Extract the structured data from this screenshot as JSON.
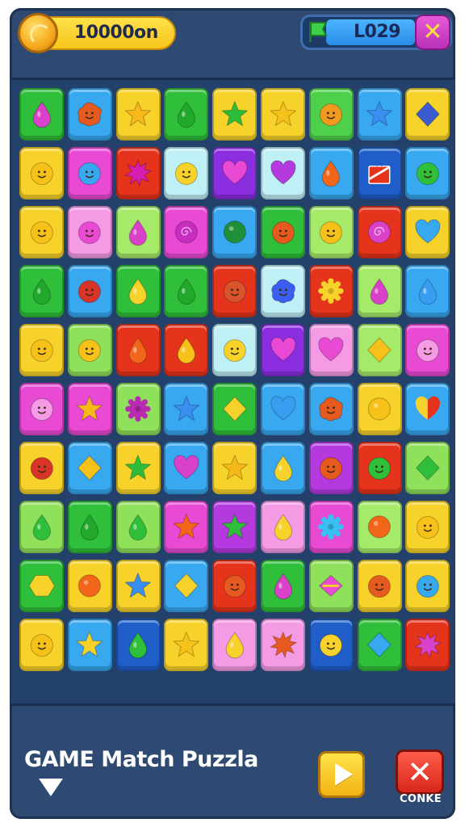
{
  "header": {
    "coins": "10000on",
    "level": "L029",
    "close_symbol": "✕",
    "coin_icon": "gold-coin-icon",
    "level_icon": "green-flag-icon"
  },
  "board": {
    "rows": 10,
    "cols": 9,
    "tiles": [
      [
        [
          "#2fbf3a",
          "drop",
          "#d942c8"
        ],
        [
          "#38a8f0",
          "blob",
          "#e55a1f"
        ],
        [
          "#f6d22a",
          "star",
          "#f6b81a"
        ],
        [
          "#2fbf3a",
          "drop",
          "#22a82a"
        ],
        [
          "#f6d22a",
          "star",
          "#2ebd3a"
        ],
        [
          "#f6d22a",
          "star",
          "#f6c21a"
        ],
        [
          "#4fd04a",
          "face",
          "#f19a20"
        ],
        [
          "#38a8f0",
          "star",
          "#3a8ef0"
        ],
        [
          "#f6d22a",
          "diamond",
          "#3b5bd0"
        ]
      ],
      [
        [
          "#f6d22a",
          "face",
          "#f6c21a"
        ],
        [
          "#e84ad4",
          "face",
          "#38a8f0"
        ],
        [
          "#e6341c",
          "splat",
          "#d61eb0"
        ],
        [
          "#bff0f5",
          "face",
          "#f6d22a"
        ],
        [
          "#8a2ee0",
          "heart",
          "#e84ad4"
        ],
        [
          "#bff0f5",
          "heart",
          "#b43ae0"
        ],
        [
          "#38a8f0",
          "drop",
          "#f2661a"
        ],
        [
          "#1f5ec8",
          "gift",
          "#e6341c"
        ],
        [
          "#38a8f0",
          "face",
          "#2fbf3a"
        ]
      ],
      [
        [
          "#f6d22a",
          "face",
          "#f6c21a"
        ],
        [
          "#f59be6",
          "face",
          "#e84ad4"
        ],
        [
          "#a6ea6a",
          "drop",
          "#d942c8"
        ],
        [
          "#e84ad4",
          "swirl",
          "#c72ec0"
        ],
        [
          "#38a8f0",
          "circle",
          "#1f8f3a"
        ],
        [
          "#2fbf3a",
          "face",
          "#e65a1f"
        ],
        [
          "#a6ea6a",
          "face",
          "#f6c21a"
        ],
        [
          "#e6341c",
          "swirl",
          "#d942c8"
        ],
        [
          "#f6d22a",
          "heart",
          "#38a8f0"
        ]
      ],
      [
        [
          "#2fbf3a",
          "drop",
          "#22a82a"
        ],
        [
          "#38a8f0",
          "face",
          "#d9342a"
        ],
        [
          "#2fbf3a",
          "drop",
          "#f6d22a"
        ],
        [
          "#2fbf3a",
          "drop",
          "#22a82a"
        ],
        [
          "#e6341c",
          "face",
          "#d9542a"
        ],
        [
          "#bff0f5",
          "blob",
          "#3a5ef0"
        ],
        [
          "#e6341c",
          "gear",
          "#f6d22a"
        ],
        [
          "#a6ea6a",
          "drop",
          "#d942c8"
        ],
        [
          "#38a8f0",
          "drop",
          "#3a9ef0"
        ]
      ],
      [
        [
          "#f6d22a",
          "face",
          "#f6c21a"
        ],
        [
          "#8fe05a",
          "face",
          "#f6c21a"
        ],
        [
          "#e6341c",
          "drop",
          "#f2661a"
        ],
        [
          "#e6341c",
          "drop",
          "#f6c21a"
        ],
        [
          "#bff0f5",
          "face",
          "#f6d22a"
        ],
        [
          "#8a2ee0",
          "heart",
          "#e84ad4"
        ],
        [
          "#f59be6",
          "heart",
          "#e84ad4"
        ],
        [
          "#a6ea6a",
          "diamond",
          "#f6c21a"
        ],
        [
          "#e84ad4",
          "face",
          "#f59be6"
        ]
      ],
      [
        [
          "#e84ad4",
          "face",
          "#f59be6"
        ],
        [
          "#e84ad4",
          "star",
          "#f6b81a"
        ],
        [
          "#8fe05a",
          "gear",
          "#b82ab0"
        ],
        [
          "#38a8f0",
          "star",
          "#3a8ef0"
        ],
        [
          "#2fbf3a",
          "diamond",
          "#f6d22a"
        ],
        [
          "#38a8f0",
          "heart",
          "#3a9ef0"
        ],
        [
          "#38a8f0",
          "blob",
          "#e55a1f"
        ],
        [
          "#f6d22a",
          "circle",
          "#f6c21a"
        ],
        [
          "#38a8f0",
          "halfheart",
          "#f6d22a"
        ]
      ],
      [
        [
          "#f6d22a",
          "face",
          "#d9342a"
        ],
        [
          "#38a8f0",
          "diamond",
          "#f6c21a"
        ],
        [
          "#f6d22a",
          "star",
          "#2ebd3a"
        ],
        [
          "#38a8f0",
          "heart",
          "#d942c8"
        ],
        [
          "#f6d22a",
          "star",
          "#f6b81a"
        ],
        [
          "#38a8f0",
          "drop",
          "#f6d22a"
        ],
        [
          "#b43ae0",
          "face",
          "#e65a1f"
        ],
        [
          "#e6341c",
          "face",
          "#2fbf3a"
        ],
        [
          "#8fe05a",
          "diamond",
          "#2fbf3a"
        ]
      ],
      [
        [
          "#8fe05a",
          "drop",
          "#2fbf3a"
        ],
        [
          "#2fbf3a",
          "drop",
          "#22a82a"
        ],
        [
          "#8fe05a",
          "drop",
          "#2fbf3a"
        ],
        [
          "#e84ad4",
          "star",
          "#f2661a"
        ],
        [
          "#b43ae0",
          "star",
          "#2fbf3a"
        ],
        [
          "#f59be6",
          "drop",
          "#f6d22a"
        ],
        [
          "#e84ad4",
          "gear",
          "#38c0f0"
        ],
        [
          "#a6ea6a",
          "circle",
          "#f2661a"
        ],
        [
          "#f6d22a",
          "face",
          "#f6c21a"
        ]
      ],
      [
        [
          "#2fbf3a",
          "hexa",
          "#f6d22a"
        ],
        [
          "#f6d22a",
          "circle",
          "#f2661a"
        ],
        [
          "#f6d22a",
          "star",
          "#3a8ef0"
        ],
        [
          "#38a8f0",
          "diamond",
          "#f6d22a"
        ],
        [
          "#e6341c",
          "face",
          "#e65a1f"
        ],
        [
          "#2fbf3a",
          "drop",
          "#d942c8"
        ],
        [
          "#8fe05a",
          "candy",
          "#e84ad4"
        ],
        [
          "#f6d22a",
          "face",
          "#e65a1f"
        ],
        [
          "#f6d22a",
          "face",
          "#38a8f0"
        ]
      ],
      [
        [
          "#f6d22a",
          "face",
          "#f6c21a"
        ],
        [
          "#38a8f0",
          "star",
          "#f6d22a"
        ],
        [
          "#1f5ec8",
          "drop",
          "#2fbf3a"
        ],
        [
          "#f6d22a",
          "star",
          "#f6c21a"
        ],
        [
          "#f59be6",
          "drop",
          "#f6d22a"
        ],
        [
          "#f59be6",
          "splat",
          "#e65a1f"
        ],
        [
          "#1f5ec8",
          "face",
          "#f6d22a"
        ],
        [
          "#2fbf3a",
          "diamond",
          "#38a8f0"
        ],
        [
          "#e6341c",
          "splat",
          "#d942c8"
        ]
      ]
    ]
  },
  "footer": {
    "title": "GAME Match Puzzla",
    "close_label": "CONKE",
    "close_symbol": "✕",
    "play_icon": "play-icon",
    "down_icon": "down-arrow-icon"
  }
}
